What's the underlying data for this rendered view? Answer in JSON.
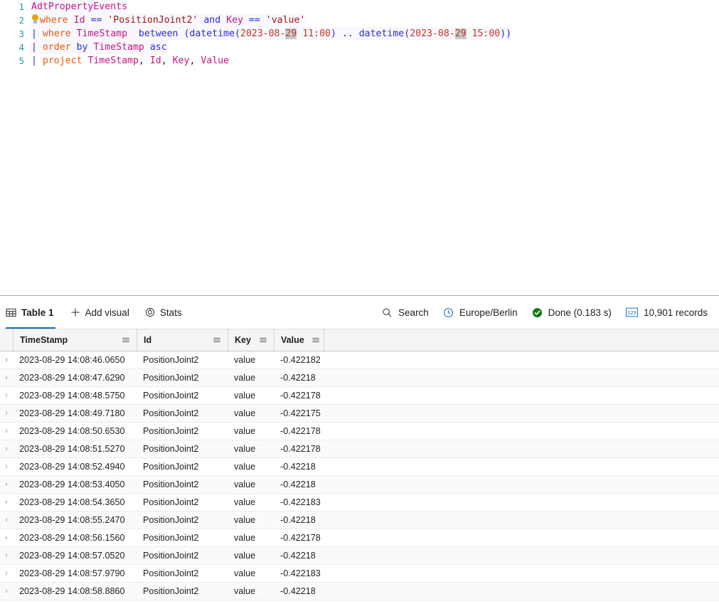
{
  "editor": {
    "lines": [
      {
        "num": "1",
        "text": "AdtPropertyEvents"
      },
      {
        "num": "2",
        "text": "where Id == 'PositionJoint2' and Key == 'value'"
      },
      {
        "num": "3",
        "text": "| where TimeStamp  between (datetime(2023-08-29 11:00) .. datetime(2023-08-29 15:00))"
      },
      {
        "num": "4",
        "text": "| order by TimeStamp asc"
      },
      {
        "num": "5",
        "text": "| project TimeStamp, Id, Key, Value"
      }
    ],
    "line1": {
      "table": "AdtPropertyEvents"
    },
    "line2": {
      "kw": "where",
      "col_id": "Id",
      "eq1": "==",
      "str_joint": "'PositionJoint2'",
      "and": "and",
      "col_key": "Key",
      "eq2": "==",
      "str_value": "'value'"
    },
    "line3": {
      "pipe": "|",
      "kw": "where",
      "col": "TimeStamp",
      "between": "between",
      "open": "(",
      "fn1": "datetime",
      "d1a": "2023-08-",
      "d1b": "29",
      "d1c": " 11:00",
      "close1": ")",
      "range": "..",
      "fn2": "datetime",
      "d2a": "2023-08-",
      "d2b": "29",
      "d2c": " 15:00",
      "close2": "))"
    },
    "line4": {
      "pipe": "|",
      "kw": "order",
      "by": "by",
      "col": "TimeStamp",
      "dir": "asc"
    },
    "line5": {
      "pipe": "|",
      "kw": "project",
      "c1": "TimeStamp",
      "c2": "Id",
      "c3": "Key",
      "c4": "Value",
      "comma": ","
    }
  },
  "toolbar": {
    "table_tab": "Table 1",
    "add_visual": "Add visual",
    "stats": "Stats",
    "search": "Search",
    "timezone": "Europe/Berlin",
    "status": "Done (0.183 s)",
    "records": "10,901 records",
    "icons": {
      "table": "table-icon",
      "add": "plus-icon",
      "stats": "stats-icon",
      "search": "search-icon",
      "clock": "clock-icon",
      "check": "check-circle-icon",
      "records": "numbers-icon"
    },
    "colors": {
      "accent": "#0f6cbd",
      "success": "#107c10"
    }
  },
  "grid": {
    "columns": [
      {
        "label": "TimeStamp",
        "menu": "column-menu-icon"
      },
      {
        "label": "Id",
        "menu": "column-menu-icon"
      },
      {
        "label": "Key",
        "menu": "column-menu-icon"
      },
      {
        "label": "Value",
        "menu": "column-menu-icon"
      }
    ],
    "rows": [
      {
        "TimeStamp": "2023-08-29 14:08:46.0650",
        "Id": "PositionJoint2",
        "Key": "value",
        "Value": "-0.422182"
      },
      {
        "TimeStamp": "2023-08-29 14:08:47.6290",
        "Id": "PositionJoint2",
        "Key": "value",
        "Value": "-0.42218"
      },
      {
        "TimeStamp": "2023-08-29 14:08:48.5750",
        "Id": "PositionJoint2",
        "Key": "value",
        "Value": "-0.422178"
      },
      {
        "TimeStamp": "2023-08-29 14:08:49.7180",
        "Id": "PositionJoint2",
        "Key": "value",
        "Value": "-0.422175"
      },
      {
        "TimeStamp": "2023-08-29 14:08:50.6530",
        "Id": "PositionJoint2",
        "Key": "value",
        "Value": "-0.422178"
      },
      {
        "TimeStamp": "2023-08-29 14:08:51.5270",
        "Id": "PositionJoint2",
        "Key": "value",
        "Value": "-0.422178"
      },
      {
        "TimeStamp": "2023-08-29 14:08:52.4940",
        "Id": "PositionJoint2",
        "Key": "value",
        "Value": "-0.42218"
      },
      {
        "TimeStamp": "2023-08-29 14:08:53.4050",
        "Id": "PositionJoint2",
        "Key": "value",
        "Value": "-0.42218"
      },
      {
        "TimeStamp": "2023-08-29 14:08:54.3650",
        "Id": "PositionJoint2",
        "Key": "value",
        "Value": "-0.422183"
      },
      {
        "TimeStamp": "2023-08-29 14:08:55.2470",
        "Id": "PositionJoint2",
        "Key": "value",
        "Value": "-0.42218"
      },
      {
        "TimeStamp": "2023-08-29 14:08:56.1560",
        "Id": "PositionJoint2",
        "Key": "value",
        "Value": "-0.422178"
      },
      {
        "TimeStamp": "2023-08-29 14:08:57.0520",
        "Id": "PositionJoint2",
        "Key": "value",
        "Value": "-0.42218"
      },
      {
        "TimeStamp": "2023-08-29 14:08:57.9790",
        "Id": "PositionJoint2",
        "Key": "value",
        "Value": "-0.422183"
      },
      {
        "TimeStamp": "2023-08-29 14:08:58.8860",
        "Id": "PositionJoint2",
        "Key": "value",
        "Value": "-0.42218"
      }
    ],
    "row_expand_icon": "chevron-right-icon"
  }
}
